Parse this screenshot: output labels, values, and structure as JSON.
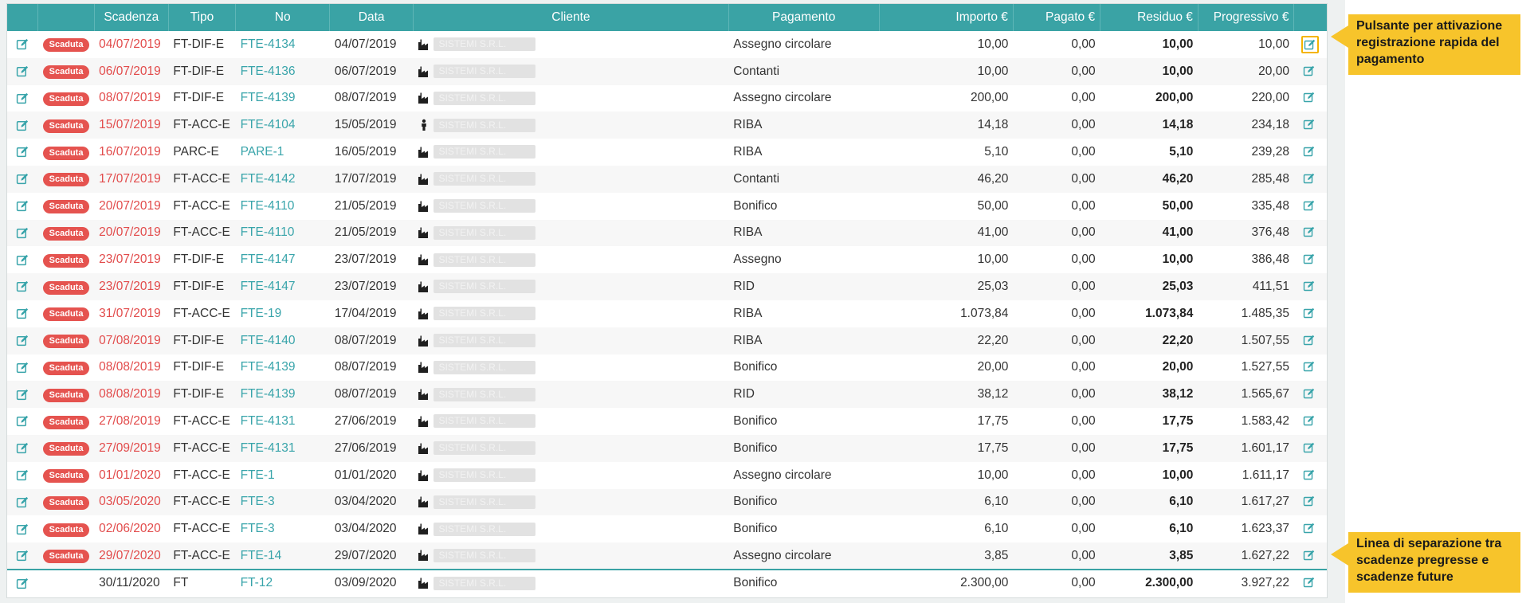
{
  "table": {
    "columns": [
      "",
      "",
      "Scadenza",
      "Tipo",
      "No",
      "Data",
      "Cliente",
      "Pagamento",
      "Importo €",
      "Pagato €",
      "Residuo €",
      "Progressivo €",
      ""
    ],
    "badge_text": "Scaduta",
    "client_placeholder": "SISTEMI S.R.L.",
    "rows": [
      {
        "overdue": true,
        "scadenza": "04/07/2019",
        "tipo": "FT-DIF-E",
        "no": "FTE-4134",
        "data": "04/07/2019",
        "client_icon": "factory-icon",
        "pagamento": "Assegno circolare",
        "importo": "10,00",
        "pagato": "0,00",
        "residuo": "10,00",
        "progressivo": "10,00"
      },
      {
        "overdue": true,
        "scadenza": "06/07/2019",
        "tipo": "FT-DIF-E",
        "no": "FTE-4136",
        "data": "06/07/2019",
        "client_icon": "factory-icon",
        "pagamento": "Contanti",
        "importo": "10,00",
        "pagato": "0,00",
        "residuo": "10,00",
        "progressivo": "20,00"
      },
      {
        "overdue": true,
        "scadenza": "08/07/2019",
        "tipo": "FT-DIF-E",
        "no": "FTE-4139",
        "data": "08/07/2019",
        "client_icon": "factory-icon",
        "pagamento": "Assegno circolare",
        "importo": "200,00",
        "pagato": "0,00",
        "residuo": "200,00",
        "progressivo": "220,00"
      },
      {
        "overdue": true,
        "scadenza": "15/07/2019",
        "tipo": "FT-ACC-E",
        "no": "FTE-4104",
        "data": "15/05/2019",
        "client_icon": "person-icon",
        "pagamento": "RIBA",
        "importo": "14,18",
        "pagato": "0,00",
        "residuo": "14,18",
        "progressivo": "234,18"
      },
      {
        "overdue": true,
        "scadenza": "16/07/2019",
        "tipo": "PARC-E",
        "no": "PARE-1",
        "data": "16/05/2019",
        "client_icon": "factory-icon",
        "pagamento": "RIBA",
        "importo": "5,10",
        "pagato": "0,00",
        "residuo": "5,10",
        "progressivo": "239,28"
      },
      {
        "overdue": true,
        "scadenza": "17/07/2019",
        "tipo": "FT-ACC-E",
        "no": "FTE-4142",
        "data": "17/07/2019",
        "client_icon": "factory-icon",
        "pagamento": "Contanti",
        "importo": "46,20",
        "pagato": "0,00",
        "residuo": "46,20",
        "progressivo": "285,48"
      },
      {
        "overdue": true,
        "scadenza": "20/07/2019",
        "tipo": "FT-ACC-E",
        "no": "FTE-4110",
        "data": "21/05/2019",
        "client_icon": "factory-icon",
        "pagamento": "Bonifico",
        "importo": "50,00",
        "pagato": "0,00",
        "residuo": "50,00",
        "progressivo": "335,48"
      },
      {
        "overdue": true,
        "scadenza": "20/07/2019",
        "tipo": "FT-ACC-E",
        "no": "FTE-4110",
        "data": "21/05/2019",
        "client_icon": "factory-icon",
        "pagamento": "RIBA",
        "importo": "41,00",
        "pagato": "0,00",
        "residuo": "41,00",
        "progressivo": "376,48"
      },
      {
        "overdue": true,
        "scadenza": "23/07/2019",
        "tipo": "FT-DIF-E",
        "no": "FTE-4147",
        "data": "23/07/2019",
        "client_icon": "factory-icon",
        "pagamento": "Assegno",
        "importo": "10,00",
        "pagato": "0,00",
        "residuo": "10,00",
        "progressivo": "386,48"
      },
      {
        "overdue": true,
        "scadenza": "23/07/2019",
        "tipo": "FT-DIF-E",
        "no": "FTE-4147",
        "data": "23/07/2019",
        "client_icon": "factory-icon",
        "pagamento": "RID",
        "importo": "25,03",
        "pagato": "0,00",
        "residuo": "25,03",
        "progressivo": "411,51"
      },
      {
        "overdue": true,
        "scadenza": "31/07/2019",
        "tipo": "FT-ACC-E",
        "no": "FTE-19",
        "data": "17/04/2019",
        "client_icon": "factory-icon",
        "pagamento": "RIBA",
        "importo": "1.073,84",
        "pagato": "0,00",
        "residuo": "1.073,84",
        "progressivo": "1.485,35"
      },
      {
        "overdue": true,
        "scadenza": "07/08/2019",
        "tipo": "FT-DIF-E",
        "no": "FTE-4140",
        "data": "08/07/2019",
        "client_icon": "factory-icon",
        "pagamento": "RIBA",
        "importo": "22,20",
        "pagato": "0,00",
        "residuo": "22,20",
        "progressivo": "1.507,55"
      },
      {
        "overdue": true,
        "scadenza": "08/08/2019",
        "tipo": "FT-DIF-E",
        "no": "FTE-4139",
        "data": "08/07/2019",
        "client_icon": "factory-icon",
        "pagamento": "Bonifico",
        "importo": "20,00",
        "pagato": "0,00",
        "residuo": "20,00",
        "progressivo": "1.527,55"
      },
      {
        "overdue": true,
        "scadenza": "08/08/2019",
        "tipo": "FT-DIF-E",
        "no": "FTE-4139",
        "data": "08/07/2019",
        "client_icon": "factory-icon",
        "pagamento": "RID",
        "importo": "38,12",
        "pagato": "0,00",
        "residuo": "38,12",
        "progressivo": "1.565,67"
      },
      {
        "overdue": true,
        "scadenza": "27/08/2019",
        "tipo": "FT-ACC-E",
        "no": "FTE-4131",
        "data": "27/06/2019",
        "client_icon": "factory-icon",
        "pagamento": "Bonifico",
        "importo": "17,75",
        "pagato": "0,00",
        "residuo": "17,75",
        "progressivo": "1.583,42"
      },
      {
        "overdue": true,
        "scadenza": "27/09/2019",
        "tipo": "FT-ACC-E",
        "no": "FTE-4131",
        "data": "27/06/2019",
        "client_icon": "factory-icon",
        "pagamento": "Bonifico",
        "importo": "17,75",
        "pagato": "0,00",
        "residuo": "17,75",
        "progressivo": "1.601,17"
      },
      {
        "overdue": true,
        "scadenza": "01/01/2020",
        "tipo": "FT-ACC-E",
        "no": "FTE-1",
        "data": "01/01/2020",
        "client_icon": "factory-icon",
        "pagamento": "Assegno circolare",
        "importo": "10,00",
        "pagato": "0,00",
        "residuo": "10,00",
        "progressivo": "1.611,17"
      },
      {
        "overdue": true,
        "scadenza": "03/05/2020",
        "tipo": "FT-ACC-E",
        "no": "FTE-3",
        "data": "03/04/2020",
        "client_icon": "factory-icon",
        "pagamento": "Bonifico",
        "importo": "6,10",
        "pagato": "0,00",
        "residuo": "6,10",
        "progressivo": "1.617,27"
      },
      {
        "overdue": true,
        "scadenza": "02/06/2020",
        "tipo": "FT-ACC-E",
        "no": "FTE-3",
        "data": "03/04/2020",
        "client_icon": "factory-icon",
        "pagamento": "Bonifico",
        "importo": "6,10",
        "pagato": "0,00",
        "residuo": "6,10",
        "progressivo": "1.623,37"
      },
      {
        "overdue": true,
        "scadenza": "29/07/2020",
        "tipo": "FT-ACC-E",
        "no": "FTE-14",
        "data": "29/07/2020",
        "client_icon": "factory-icon",
        "pagamento": "Assegno circolare",
        "importo": "3,85",
        "pagato": "0,00",
        "residuo": "3,85",
        "progressivo": "1.627,22"
      },
      {
        "overdue": false,
        "scadenza": "30/11/2020",
        "tipo": "FT",
        "no": "FT-12",
        "data": "03/09/2020",
        "client_icon": "factory-icon",
        "pagamento": "Bonifico",
        "importo": "2.300,00",
        "pagato": "0,00",
        "residuo": "2.300,00",
        "progressivo": "3.927,22"
      }
    ]
  },
  "callouts": {
    "fast_payment": "Pulsante per attivazione registrazione rapida del pagamento",
    "separator": "Linea di separazione tra scadenze pregresse e scadenze future"
  },
  "colors": {
    "header": "#3aa3a5",
    "overdue_text": "#e24b4b",
    "badge": "#e5534f",
    "link": "#38a4aa",
    "callout": "#f7c42b"
  }
}
